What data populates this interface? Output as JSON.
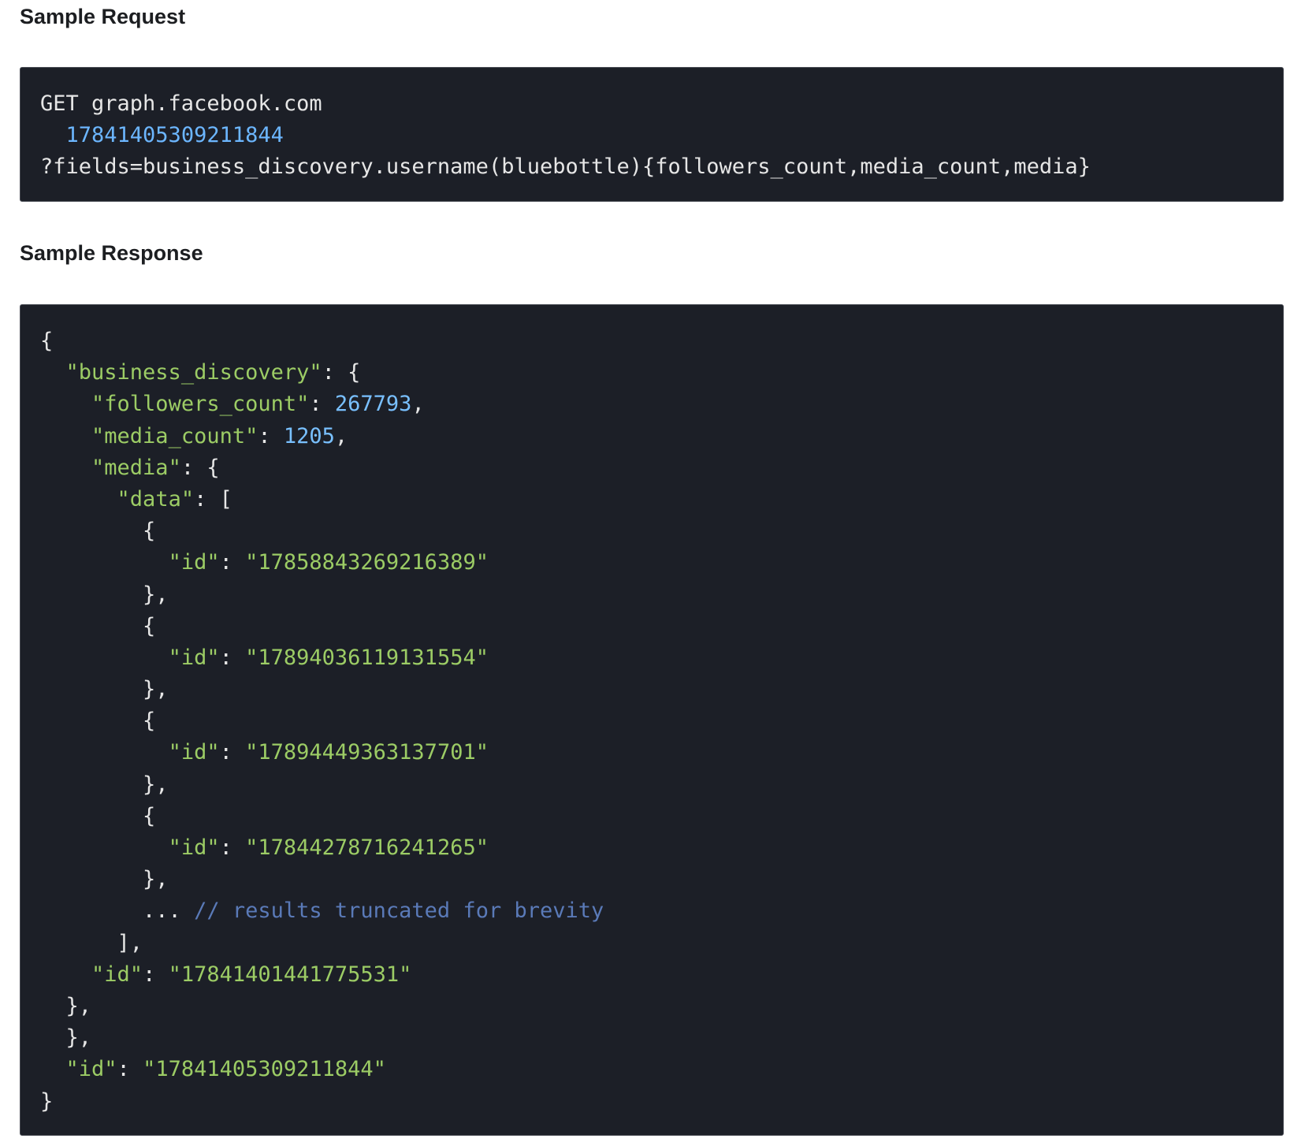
{
  "sample_request": {
    "heading": "Sample Request",
    "method_host": "GET graph.facebook.com",
    "node_id": "17841405309211844",
    "query": "?fields=business_discovery.username(bluebottle){followers_count,media_count,media}"
  },
  "sample_response": {
    "heading": "Sample Response",
    "followers_count": "267793",
    "media_count": "1205",
    "media_ids": [
      "\"17858843269216389\"",
      "\"17894036119131554\"",
      "\"17894449363137701\"",
      "\"17844278716241265\""
    ],
    "truncated_comment": "// results truncated for brevity",
    "business_id": "\"17841401441775531\"",
    "root_id": "\"17841405309211844\""
  },
  "colors": {
    "code_background": "#1c1f27",
    "json_keys_strings": "#9ccc65",
    "numbers": "#79c0ff",
    "comment": "#5a7ab8"
  }
}
